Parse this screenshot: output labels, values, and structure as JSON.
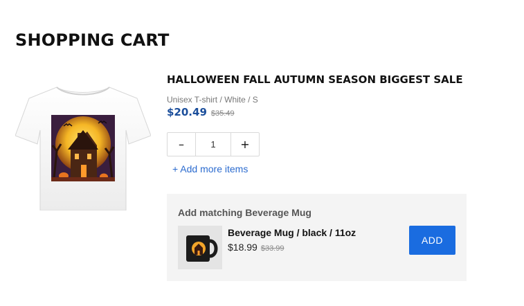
{
  "page": {
    "title": "SHOPPING CART"
  },
  "cart_item": {
    "title": "HALLOWEEN FALL AUTUMN SEASON BIGGEST SALE",
    "variant": "Unisex T-shirt / White / S",
    "price": "$20.49",
    "compare_price": "$35.49",
    "quantity": "1",
    "decrease_label": "–",
    "increase_label": "+",
    "add_more_label": "+ Add more items"
  },
  "upsell": {
    "heading": "Add matching Beverage Mug",
    "product_name": "Beverage Mug / black / 11oz",
    "price": "$18.99",
    "compare_price": "$33.99",
    "add_label": "ADD"
  },
  "colors": {
    "price": "#1b4e9b",
    "link": "#2b6bcf",
    "add_button": "#1a6ce0",
    "upsell_background": "#f4f4f4"
  }
}
